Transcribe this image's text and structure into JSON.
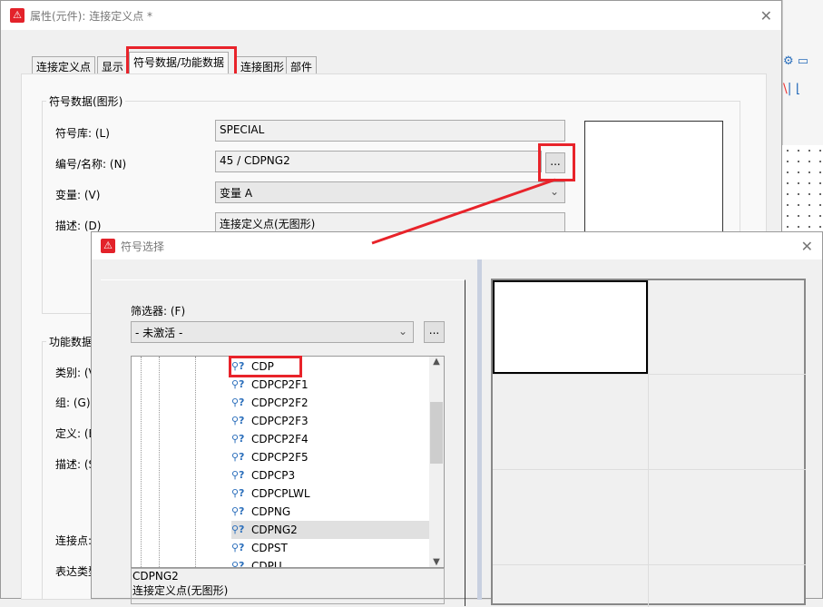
{
  "main_dialog": {
    "title": "属性(元件): 连接定义点 *",
    "tabs": [
      "连接定义点",
      "显示",
      "符号数据/功能数据",
      "连接图形",
      "部件"
    ],
    "active_tab": "符号数据/功能数据",
    "symbol_group": {
      "title": "符号数据(图形)",
      "fields": [
        {
          "label": "符号库: (L)",
          "value": "SPECIAL"
        },
        {
          "label": "编号/名称: (N)",
          "value": "45 / CDPNG2"
        },
        {
          "label": "变量: (V)",
          "value": "变量 A"
        },
        {
          "label": "描述: (D)",
          "value": "连接定义点(无图形)"
        }
      ],
      "browse_label": "..."
    },
    "function_group": {
      "title": "功能数据",
      "labels": [
        "类别: (V",
        "组: (G)",
        "定义: (E",
        "描述: (S",
        "连接点:",
        "表达类型"
      ]
    }
  },
  "symbol_dialog": {
    "title": "符号选择",
    "filter_label": "筛选器: (F)",
    "filter_value": "- 未激活 -",
    "filter_button": "...",
    "tree_items": [
      "CDP",
      "CDPCP2F1",
      "CDPCP2F2",
      "CDPCP2F3",
      "CDPCP2F4",
      "CDPCP2F5",
      "CDPCP3",
      "CDPCPLWL",
      "CDPNG",
      "CDPNG2",
      "CDPST",
      "CDPU"
    ],
    "selected_item": "CDPNG2",
    "description": {
      "name": "CDPNG2",
      "text": "连接定义点(无图形)"
    }
  },
  "colors": {
    "highlight": "#e8232a",
    "app_icon": "#e3222a"
  }
}
